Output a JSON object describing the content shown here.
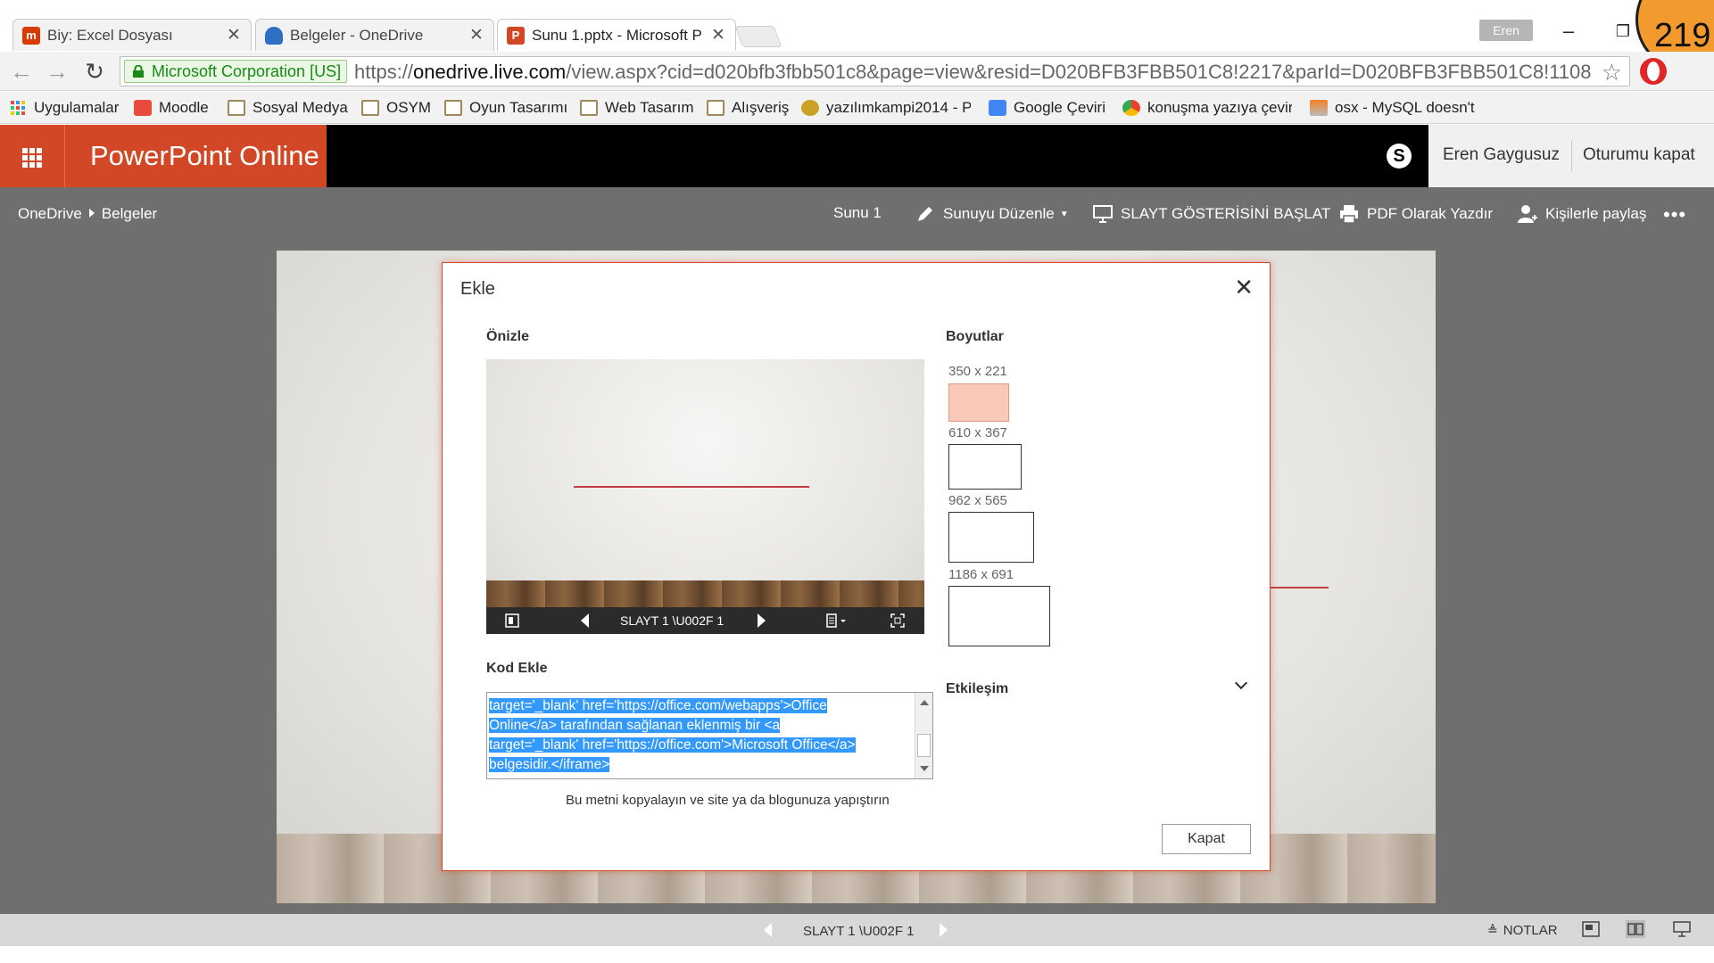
{
  "browser": {
    "tabs": [
      {
        "title": "Biy: Excel Dosyası",
        "active": false,
        "favicon": "office-icon"
      },
      {
        "title": "Belgeler - OneDrive",
        "active": false,
        "favicon": "onedrive-cloud-icon"
      },
      {
        "title": "Sunu 1.pptx - Microsoft P",
        "active": true,
        "favicon": "powerpoint-icon"
      }
    ],
    "profile_name": "Eren",
    "badge_number": "219",
    "security_label": "Microsoft Corporation [US]",
    "url_prefix": "https://",
    "url_domain": "onedrive.live.com",
    "url_path": "/view.aspx?cid=d020bfb3fbb501c8&page=view&resid=D020BFB3FBB501C8!2217&parId=D020BFB3FBB501C8!1108",
    "bookmarks": [
      {
        "label": "Uygulamalar",
        "icon": "apps-grid-icon"
      },
      {
        "label": "Moodle",
        "icon": "moodle-icon"
      },
      {
        "label": "Sosyal Medya",
        "icon": "folder-icon"
      },
      {
        "label": "OSYM",
        "icon": "folder-icon"
      },
      {
        "label": "Oyun Tasarımı",
        "icon": "folder-icon"
      },
      {
        "label": "Web Tasarım",
        "icon": "folder-icon"
      },
      {
        "label": "Alışveriş",
        "icon": "folder-icon"
      },
      {
        "label": "yazılımkampi2014 - P",
        "icon": "tiger-icon"
      },
      {
        "label": "Google Çeviri",
        "icon": "google-translate-icon"
      },
      {
        "label": "konuşma yazıya çevir",
        "icon": "chrome-icon"
      },
      {
        "label": "osx - MySQL doesn't s",
        "icon": "stackoverflow-icon"
      }
    ]
  },
  "office": {
    "app_name": "PowerPoint Online",
    "user_name": "Eren Gaygusuz",
    "sign_out": "Oturumu kapat",
    "accent_color": "#d24726"
  },
  "toolbar": {
    "breadcrumb": [
      "OneDrive",
      "Belgeler"
    ],
    "doc_name": "Sunu 1",
    "edit": "Sunuyu Düzenle",
    "slideshow": "SLAYT GÖSTERİSİNİ BAŞLAT",
    "pdf": "PDF Olarak Yazdır",
    "share": "Kişilerle paylaş"
  },
  "dialog": {
    "title": "Ekle",
    "preview_label": "Önizle",
    "preview_counter": "SLAYT 1 \\U002F 1",
    "sizes_label": "Boyutlar",
    "sizes": [
      "350 x 221",
      "610 x 367",
      "962 x 565",
      "1186 x 691"
    ],
    "selected_size": "350 x 221",
    "code_label": "Kod Ekle",
    "code_lines": [
      "target='_blank' href='https://office.com/webapps'>Office",
      "Online</a> tarafından sağlanan eklenmiş bir <a",
      "target='_blank' href='https://office.com'>Microsoft Office</a>",
      "belgesidir.</iframe>"
    ],
    "hint": "Bu metni kopyalayın ve site ya da blogunuza yapıştırın",
    "interaction_label": "Etkileşim",
    "close_button": "Kapat"
  },
  "statusbar": {
    "slide_counter": "SLAYT 1 \\U002F 1",
    "notes": "NOTLAR"
  }
}
